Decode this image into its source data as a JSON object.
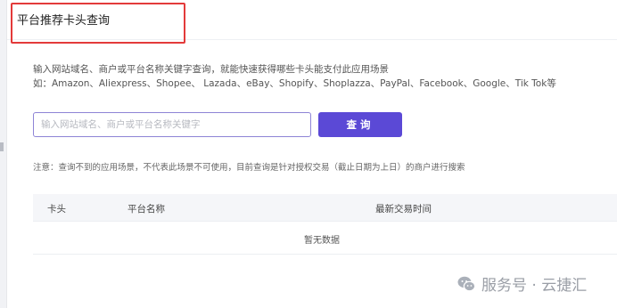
{
  "header": {
    "title": "平台推荐卡头查询"
  },
  "description": {
    "line1": "输入网站域名、商户或平台名称关键字查询，就能快速获得哪些卡头能支付此应用场景",
    "line2": "如：Amazon、Aliexpress、Shopee、 Lazada、eBay、Shopify、Shoplazza、PayPal、Facebook、Google、Tik Tok等"
  },
  "search": {
    "placeholder": "输入网站域名、商户或平台名称关键字",
    "value": "",
    "button_label": "查询"
  },
  "notice": "注意：查询不到的应用场景，不代表此场景不可使用，目前查询是针对授权交易（截止日期为上日）的商户进行搜索",
  "table": {
    "columns": [
      "卡头",
      "平台名称",
      "最新交易时间"
    ],
    "rows": [],
    "empty_text": "暂无数据"
  },
  "watermark": {
    "text": "服务号 · 云捷汇",
    "icon": "wechat-icon"
  },
  "colors": {
    "accent": "#5b49d6",
    "highlight_border": "#e33a3a",
    "input_border": "#8e84d6"
  }
}
